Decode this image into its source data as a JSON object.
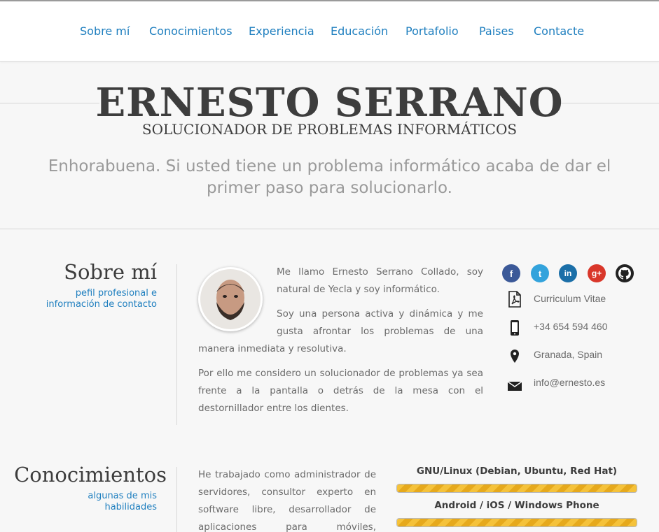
{
  "nav": {
    "items": [
      "Sobre mí",
      "Conocimientos",
      "Experiencia",
      "Educación",
      "Portafolio",
      "Paises",
      "Contacte"
    ]
  },
  "header": {
    "name": "ERNESTO SERRANO",
    "tagline": "SOLUCIONADOR DE PROBLEMAS INFORMÁTICOS",
    "lead": "Enhorabuena. Si usted tiene un problema informático acaba de dar el primer paso para solucionarlo."
  },
  "about": {
    "title": "Sobre mí",
    "subtitle_line1": "pefil profesional e",
    "subtitle_line2": "información de contacto",
    "p1": "Me llamo Ernesto Serrano Collado, soy natural de Yecla y soy informático.",
    "p2": "Soy una persona activa y dinámica y me gusta afrontar los problemas de una manera inmediata y resolutiva.",
    "p3": "Por ello me considero un solucionador de problemas ya sea frente a la pantalla o detrás de la mesa con el destornillador entre los dientes.",
    "social": [
      {
        "icon": "facebook-icon",
        "glyph": "f",
        "color": "#3b5998"
      },
      {
        "icon": "twitter-icon",
        "glyph": "t",
        "color": "#33a3dc"
      },
      {
        "icon": "linkedin-icon",
        "glyph": "in",
        "color": "#1b6fa8"
      },
      {
        "icon": "google-plus-icon",
        "glyph": "g+",
        "color": "#d9372a"
      },
      {
        "icon": "github-icon",
        "glyph": "",
        "color": "#222222"
      }
    ],
    "contact": {
      "cv": "Curriculum Vitae",
      "phone": "+34 654 594 460",
      "location": "Granada, Spain",
      "email": "info@ernesto.es"
    }
  },
  "skills": {
    "title": "Conocimientos",
    "subtitle_line1": "algunas de mis",
    "subtitle_line2": "habilidades",
    "text": "He trabajado como administrador de servidores, consultor experto en software libre, desarrollador de aplicaciones para móviles, programador",
    "items": [
      {
        "label": "GNU/Linux (Debian, Ubuntu, Red Hat)",
        "level": 1.0
      },
      {
        "label": "Android / iOS / Windows Phone",
        "level": 1.0
      }
    ]
  },
  "colors": {
    "accent": "#1f7fbf",
    "bar": "#f5c23a"
  }
}
